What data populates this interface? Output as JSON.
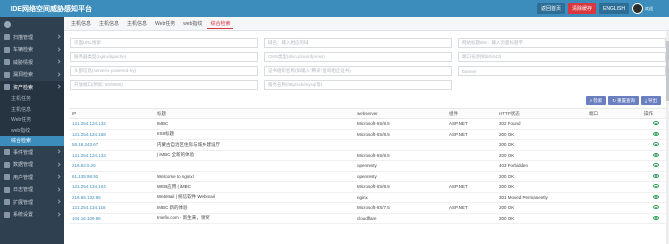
{
  "header": {
    "title": "TIDE网络空间威胁感知平台",
    "buttons": [
      "返回首页",
      "清除缓存",
      "ENGLISH"
    ],
    "user_name": "欢迎"
  },
  "tabs": [
    {
      "label": "主机信息",
      "active": false
    },
    {
      "label": "主机信息",
      "active": false
    },
    {
      "label": "主机信息",
      "active": false
    },
    {
      "label": "Web任务",
      "active": false
    },
    {
      "label": "web指纹",
      "active": false
    },
    {
      "label": "综合检索",
      "active": true
    }
  ],
  "sidebar": {
    "items": [
      {
        "label": "扫描管理",
        "expanded": false
      },
      {
        "label": "车辆检索",
        "expanded": false
      },
      {
        "label": "威胁情报",
        "expanded": false
      },
      {
        "label": "漏洞检索",
        "expanded": false
      },
      {
        "label": "资产检索",
        "expanded": true,
        "children": [
          {
            "label": "主机任务",
            "active": false
          },
          {
            "label": "主机信息",
            "active": false
          },
          {
            "label": "Web任务",
            "active": false
          },
          {
            "label": "web指纹",
            "active": false
          },
          {
            "label": "综合检索",
            "active": true
          }
        ]
      },
      {
        "label": "事件管理",
        "expanded": false
      },
      {
        "label": "数据管理",
        "expanded": false
      },
      {
        "label": "用户管理",
        "expanded": false
      },
      {
        "label": "日志管理",
        "expanded": false
      },
      {
        "label": "扩展管理",
        "expanded": false
      },
      {
        "label": "系统设置",
        "expanded": false
      }
    ]
  },
  "filter": {
    "fields": [
      "页面URL搜索",
      "域名：输入相应的域",
      "网站标题title：输入页面标题字",
      "服务器类型(nginx/apache)",
      "CMS类型(discuz/wordpress)",
      "端口号(例如80/443)",
      "头部信息(server/x-powered-by)",
      "证书组织名称(如输入\"腾讯\"查询相应证书)",
      "Banner",
      "开放端口(例如: 80/8080)",
      "服务名称(http/ssh/mysql等)"
    ]
  },
  "actions": [
    "检索",
    "重置查询",
    "导出"
  ],
  "table": {
    "columns": [
      "IP",
      "标题",
      "webserver",
      "组件",
      "HTTP状态",
      "端口",
      "操作"
    ],
    "rows": [
      [
        "121.254.134.132",
        "IMBC",
        "Microsoft-IIS/8.5",
        "ASP.NET",
        "302 Found",
        "",
        "eye"
      ],
      [
        "121.254.134.168",
        "IIS8标题",
        "Microsoft-IIS/8.5",
        "ASP.NET",
        "200 OK",
        "",
        "eye"
      ],
      [
        "58.18.243.67",
        "内蒙古自治区住房与城乡建设厅",
        "",
        "",
        "200 OK",
        "",
        "eye"
      ],
      [
        "121.254.134.133",
        "| iMBC 全新的体验",
        "Microsoft-IIS/8.5",
        "",
        "200 OK",
        "",
        "eye"
      ],
      [
        "218.83.5.26",
        "",
        "openresty",
        "",
        "403 Forbidden",
        "",
        "eye"
      ],
      [
        "61.138.98.92",
        "Welcome to nginx!",
        "openresty",
        "",
        "200 OK",
        "",
        "eye"
      ],
      [
        "121.254.134.104",
        "WEB应用 | iMBC",
        "Microsoft-IIS/8.5",
        "ASP.NET",
        "200 OK",
        "",
        "eye"
      ],
      [
        "218.65.132.96",
        "WebMail | 统信软件 Webmail",
        "nginx",
        "",
        "301 Moved Permanently",
        "",
        "eye"
      ],
      [
        "121.254.134.118",
        "IMBC 新的体验",
        "Microsoft-IIS/7.5",
        "ASP.NET",
        "200 OK",
        "",
        "eye"
      ],
      [
        "104.16.109.96",
        "Imefix.com - 新生来，领奖",
        "cloudflare",
        "",
        "200 OK",
        "",
        "eye"
      ]
    ]
  }
}
